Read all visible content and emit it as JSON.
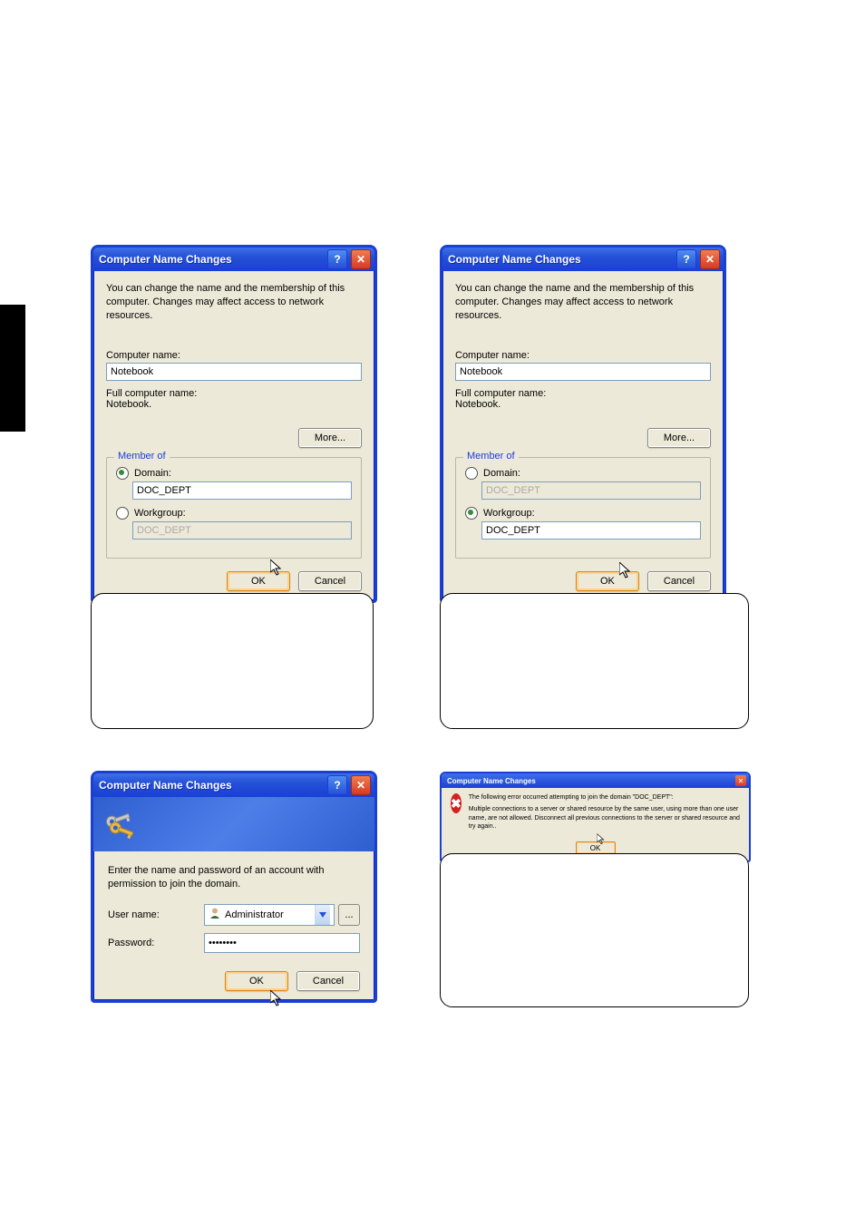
{
  "dialog1": {
    "title": "Computer Name Changes",
    "desc": "You can change the name and the membership of this computer. Changes may affect access to network resources.",
    "computer_name_label": "Computer name:",
    "computer_name_value": "Notebook",
    "full_name_label": "Full computer name:",
    "full_name_value": "Notebook.",
    "more_label": "More...",
    "member_of_label": "Member of",
    "domain_label": "Domain:",
    "domain_value": "DOC_DEPT",
    "workgroup_label": "Workgroup:",
    "workgroup_value": "DOC_DEPT",
    "ok_label": "OK",
    "cancel_label": "Cancel",
    "selection": "domain"
  },
  "dialog2": {
    "title": "Computer Name Changes",
    "desc": "You can change the name and the membership of this computer. Changes may affect access to network resources.",
    "computer_name_label": "Computer name:",
    "computer_name_value": "Notebook",
    "full_name_label": "Full computer name:",
    "full_name_value": "Notebook.",
    "more_label": "More...",
    "member_of_label": "Member of",
    "domain_label": "Domain:",
    "domain_value": "DOC_DEPT",
    "workgroup_label": "Workgroup:",
    "workgroup_value": "DOC_DEPT",
    "ok_label": "OK",
    "cancel_label": "Cancel",
    "selection": "workgroup"
  },
  "cred": {
    "title": "Computer Name Changes",
    "desc": "Enter the name and password of an account with permission to join the domain.",
    "username_label": "User name:",
    "username_value": "Administrator",
    "password_label": "Password:",
    "password_value": "••••••••",
    "browse_label": "...",
    "ok_label": "OK",
    "cancel_label": "Cancel"
  },
  "err": {
    "title": "Computer Name Changes",
    "line1": "The following error occurred attempting to join the domain \"DOC_DEPT\":",
    "line2": "Multiple connections to a server or shared resource by the same user, using more than one user name, are not allowed. Disconnect all previous connections to the server or shared resource and try again..",
    "ok_label": "OK"
  }
}
